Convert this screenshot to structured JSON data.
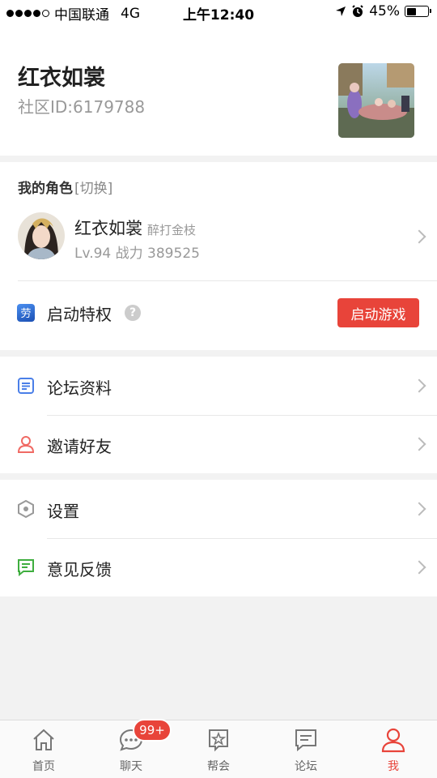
{
  "status_bar": {
    "carrier": "中国联通",
    "network": "4G",
    "time": "上午12:40",
    "battery": "45%",
    "battery_level": 0.45
  },
  "profile": {
    "name": "红衣如裳",
    "community_id": "社区ID:6179788"
  },
  "role_section": {
    "title": "我的角色",
    "switch_label": "[切换]",
    "character": {
      "name": "红衣如裳",
      "tag": "醉打金枝",
      "meta": "Lv.94 战力 389525"
    },
    "privilege_label": "启动特权",
    "launch_button": "启动游戏"
  },
  "menu_group_1": [
    {
      "label": "论坛资料",
      "icon": "document-icon",
      "color": "#4a7fe8"
    },
    {
      "label": "邀请好友",
      "icon": "person-icon",
      "color": "#f06a64"
    }
  ],
  "menu_group_2": [
    {
      "label": "设置",
      "icon": "hexagon-settings-icon",
      "color": "#999999"
    },
    {
      "label": "意见反馈",
      "icon": "message-icon",
      "color": "#3fae3f"
    }
  ],
  "tabbar": {
    "tabs": [
      {
        "label": "首页",
        "icon": "home-icon"
      },
      {
        "label": "聊天",
        "icon": "chat-icon"
      },
      {
        "label": "帮会",
        "icon": "flag-star-icon"
      },
      {
        "label": "论坛",
        "icon": "forum-icon"
      },
      {
        "label": "我",
        "icon": "user-icon"
      }
    ],
    "chat_badge": "99+",
    "active_index": 4
  },
  "colors": {
    "accent": "#e8443a",
    "background": "#f2f2f2"
  }
}
